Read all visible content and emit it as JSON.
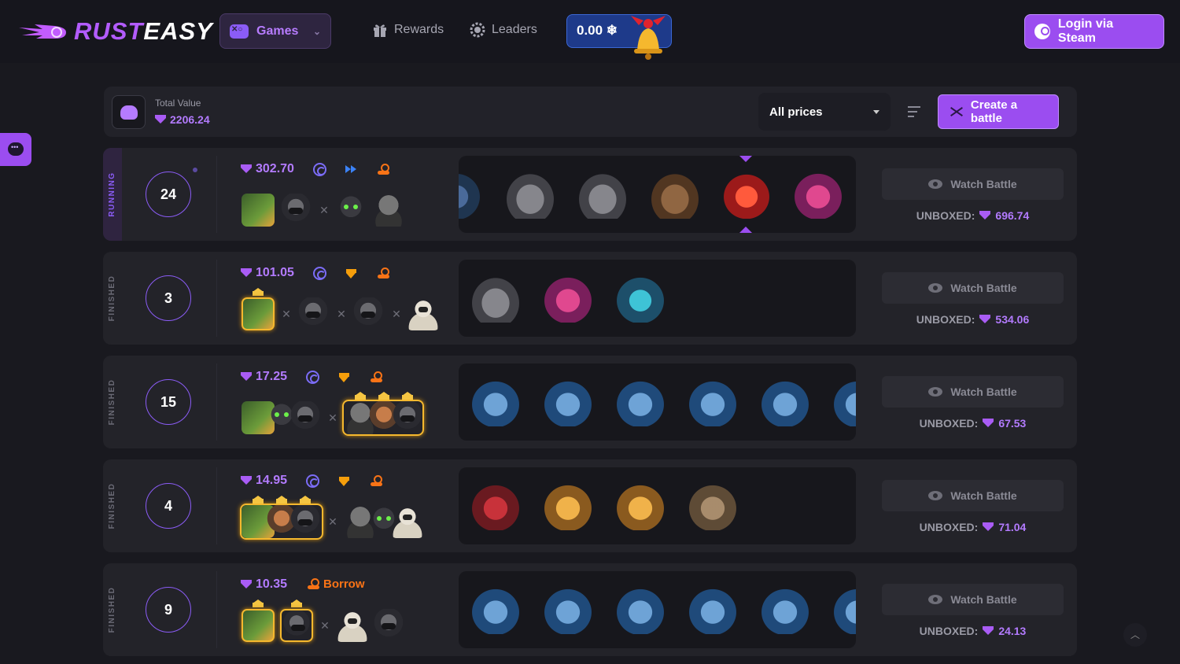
{
  "header": {
    "logo_part1": "RUST",
    "logo_part2": "EASY",
    "games_label": "Games",
    "nav": [
      {
        "label": "Rewards",
        "icon": "gift-icon"
      },
      {
        "label": "Leaders",
        "icon": "badge-icon"
      }
    ],
    "balance": "0.00 ❄",
    "login_label": "Login via Steam"
  },
  "summary": {
    "total_label": "Total Value",
    "total_value": "2206.24",
    "price_filter": "All prices",
    "create_label": "Create a battle"
  },
  "battles": [
    {
      "status": "RUNNING",
      "rounds": "24",
      "cost": "302.70",
      "watch": "Watch Battle",
      "unboxed_label": "UNBOXED:",
      "unboxed": "696.74"
    },
    {
      "status": "FINISHED",
      "rounds": "3",
      "cost": "101.05",
      "watch": "Watch Battle",
      "unboxed_label": "UNBOXED:",
      "unboxed": "534.06"
    },
    {
      "status": "FINISHED",
      "rounds": "15",
      "cost": "17.25",
      "watch": "Watch Battle",
      "unboxed_label": "UNBOXED:",
      "unboxed": "67.53"
    },
    {
      "status": "FINISHED",
      "rounds": "4",
      "cost": "14.95",
      "watch": "Watch Battle",
      "unboxed_label": "UNBOXED:",
      "unboxed": "71.04"
    },
    {
      "status": "FINISHED",
      "rounds": "9",
      "cost": "10.35",
      "borrow": "Borrow",
      "watch": "Watch Battle",
      "unboxed_label": "UNBOXED:",
      "unboxed": "24.13"
    }
  ],
  "colors": {
    "accent": "#9b4df0",
    "gem": "#b37bff",
    "winner": "#f5b82e",
    "balance_bg": "#1e3a8a"
  }
}
